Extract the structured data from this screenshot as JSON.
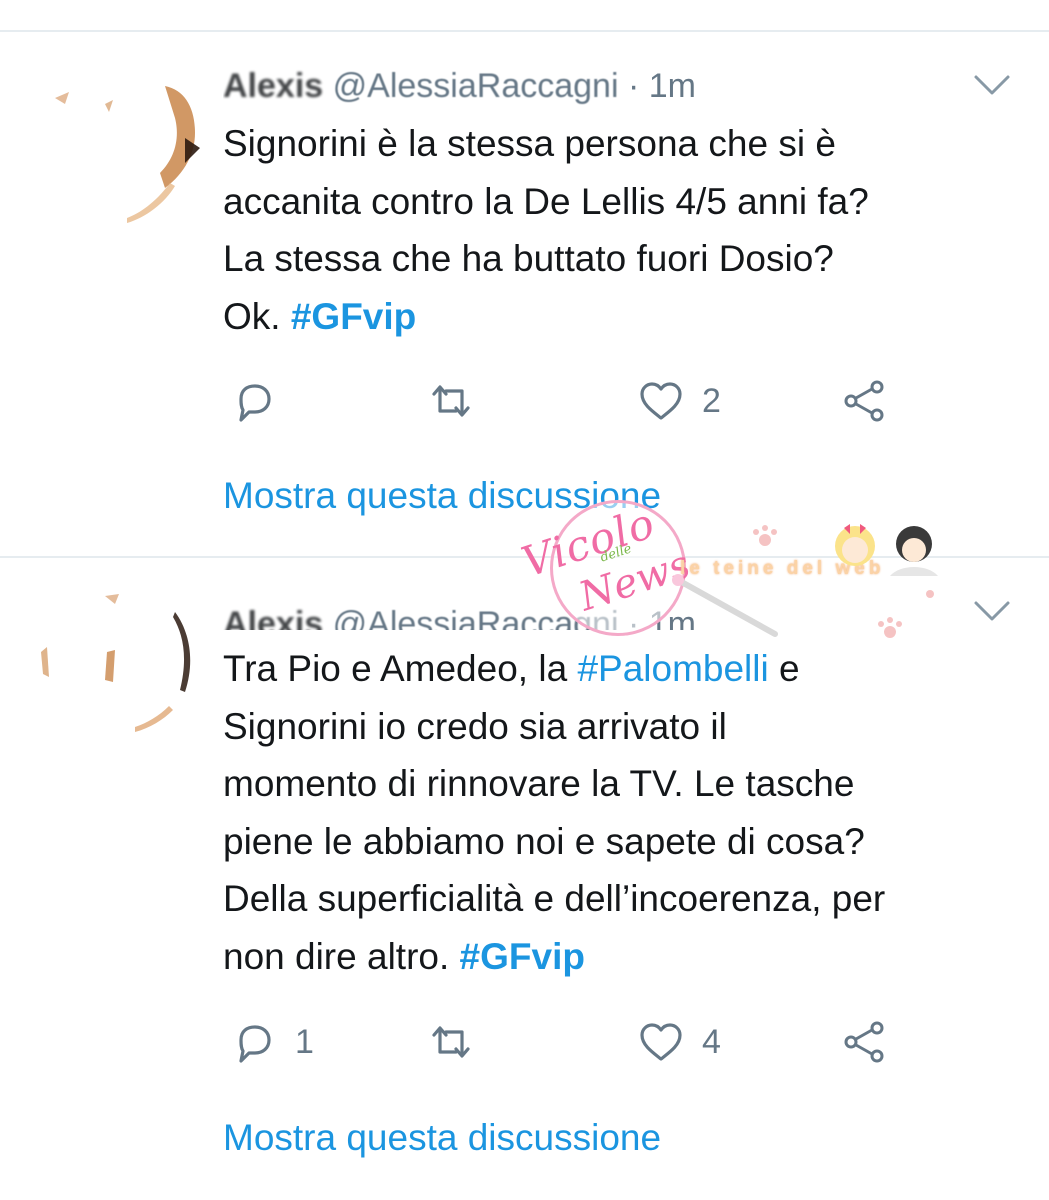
{
  "colors": {
    "link": "#1b95e0",
    "text": "#14171a",
    "muted": "#657786",
    "divider": "#e6ecf0"
  },
  "tweets": [
    {
      "name": "Alexis",
      "handle": "@AlessiaRaccagni",
      "time": "· 1m",
      "text": "Signorini è la stessa persona che si è\naccanita contro la De Lellis 4/5 anni fa?\nLa stessa che ha buttato fuori Dosio?\nOk. ",
      "hashtag": "#GFvip",
      "reply_count": "",
      "retweet_count": "",
      "like_count": "2",
      "show_thread": "Mostra questa discussione",
      "icons": [
        "reply-icon",
        "retweet-icon",
        "like-icon",
        "share-icon",
        "chevron-down-icon"
      ]
    },
    {
      "name": "Alexis",
      "handle": "@AlessiaRaccagni",
      "time": "· 1m",
      "text_before": "Tra Pio e Amedeo, la ",
      "inline_hashtag": "#Palombelli",
      "text_after": " e\nSignorini io credo sia arrivato il\nmomento di rinnovare la TV. Le tasche\npiene le abbiamo noi e sapete di cosa?\nDella superficialità e dell’incoerenza, per\nnon dire altro. ",
      "hashtag": "#GFvip",
      "reply_count": "1",
      "retweet_count": "",
      "like_count": "4",
      "show_thread": "Mostra questa discussione",
      "icons": [
        "reply-icon",
        "retweet-icon",
        "like-icon",
        "share-icon",
        "chevron-down-icon"
      ]
    }
  ],
  "watermark": {
    "line1": "Vicolo",
    "line2": "delle",
    "line3": "News",
    "band": "le teine del web"
  }
}
